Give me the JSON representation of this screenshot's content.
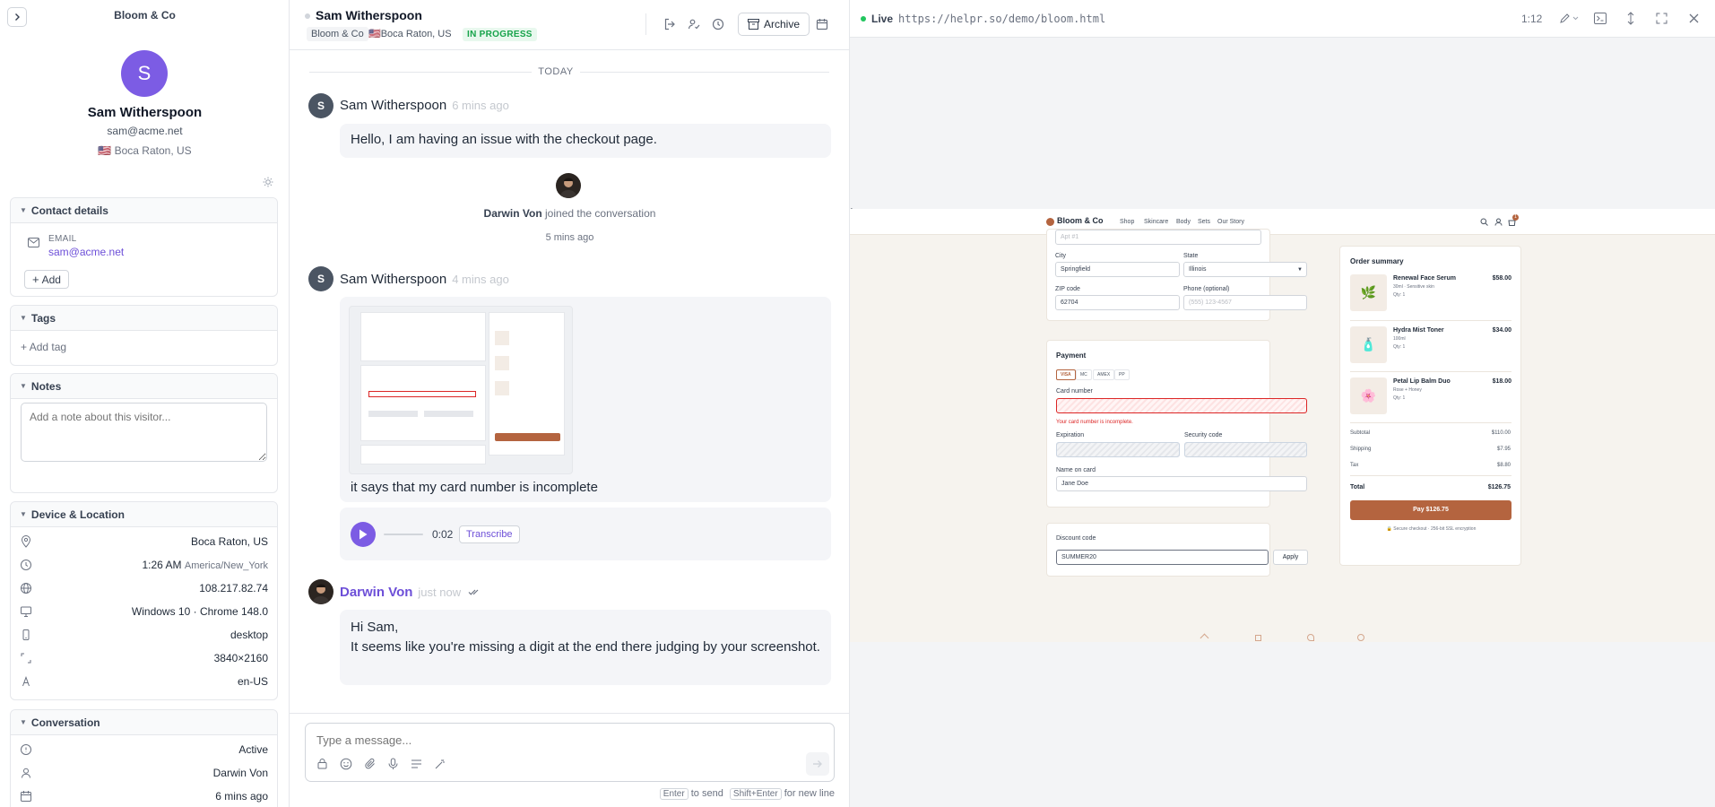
{
  "sidebar": {
    "brand": "Bloom & Co",
    "avatar_initial": "S",
    "name": "Sam Witherspoon",
    "email": "sam@acme.net",
    "flag": "🇺🇸",
    "location": "Boca Raton, US",
    "contact": {
      "title": "Contact details",
      "email_label": "EMAIL",
      "email_value": "sam@acme.net",
      "add_label": "Add"
    },
    "tags": {
      "title": "Tags",
      "add_label": "Add tag"
    },
    "notes": {
      "title": "Notes",
      "placeholder": "Add a note about this visitor..."
    },
    "device": {
      "title": "Device & Location",
      "location": "Boca Raton, US",
      "time": "1:26 AM",
      "timezone": "America/New_York",
      "ip": "108.217.82.74",
      "browser": "Windows 10 · Chrome 148.0",
      "device_type": "desktop",
      "resolution": "3840×2160",
      "language": "en-US"
    },
    "conversation": {
      "title": "Conversation",
      "status": "Active",
      "assignee": "Darwin Von",
      "started": "6 mins ago"
    }
  },
  "header": {
    "name": "Sam Witherspoon",
    "brand_chip": "Bloom & Co",
    "flag": "🇺🇸",
    "location": "Boca Raton, US",
    "status": "IN PROGRESS",
    "archive_label": "Archive"
  },
  "chat": {
    "day_divider": "TODAY",
    "messages": [
      {
        "author": "Sam Witherspoon",
        "initial": "S",
        "time": "6 mins ago",
        "text": "Hello, I am having an issue with the checkout page."
      },
      {
        "author": "Sam Witherspoon",
        "initial": "S",
        "time": "4 mins ago",
        "text": "it says that my card number is incomplete",
        "audio_time": "0:02",
        "transcribe_label": "Transcribe"
      },
      {
        "author": "Darwin Von",
        "time": "just now",
        "line1": "Hi Sam,",
        "line2": "It seems like you're missing a digit at the end there judging by your screenshot."
      }
    ],
    "join_event": {
      "name": "Darwin Von",
      "text": "joined the conversation",
      "time": "5 mins ago"
    }
  },
  "composer": {
    "placeholder": "Type a message...",
    "hint_enter": "Enter",
    "hint_send": "to send",
    "hint_shift": "Shift+Enter",
    "hint_newline": "for new line"
  },
  "preview": {
    "live_label": "Live",
    "url": "https://helpr.so/demo/bloom.html",
    "timer": "1:12",
    "shop": {
      "brand": "Bloom & Co",
      "nav": [
        "Shop",
        "Skincare",
        "Body",
        "Sets",
        "Our Story"
      ],
      "cart_count": "1",
      "apt_placeholder": "Apt #1",
      "city_label": "City",
      "city_value": "Springfield",
      "state_label": "State",
      "state_value": "Illinois",
      "zip_label": "ZIP code",
      "zip_value": "62704",
      "phone_label": "Phone (optional)",
      "phone_placeholder": "(555) 123-4567",
      "payment_title": "Payment",
      "card_types": [
        "VISA",
        "MC",
        "AMEX",
        "PP"
      ],
      "card_number_label": "Card number",
      "card_error": "Your card number is incomplete.",
      "expiration_label": "Expiration",
      "security_label": "Security code",
      "name_label": "Name on card",
      "name_value": "Jane Doe",
      "discount_label": "Discount code",
      "discount_value": "SUMMER20",
      "apply_label": "Apply",
      "summary_title": "Order summary",
      "items": [
        {
          "name": "Renewal Face Serum",
          "desc": "30ml · Sensitive skin",
          "qty": "Qty: 1",
          "price": "$58.00",
          "emoji": "🌿"
        },
        {
          "name": "Hydra Mist Toner",
          "desc": "100ml",
          "qty": "Qty: 1",
          "price": "$34.00",
          "emoji": "🧴"
        },
        {
          "name": "Petal Lip Balm Duo",
          "desc": "Rose + Honey",
          "qty": "Qty: 1",
          "price": "$18.00",
          "emoji": "🌸"
        }
      ],
      "subtotal_label": "Subtotal",
      "subtotal": "$110.00",
      "shipping_label": "Shipping",
      "shipping": "$7.95",
      "tax_label": "Tax",
      "tax": "$8.80",
      "total_label": "Total",
      "total": "$126.75",
      "pay_label": "Pay $126.75",
      "secure_note": "Secure checkout · 256-bit SSL encryption"
    }
  }
}
